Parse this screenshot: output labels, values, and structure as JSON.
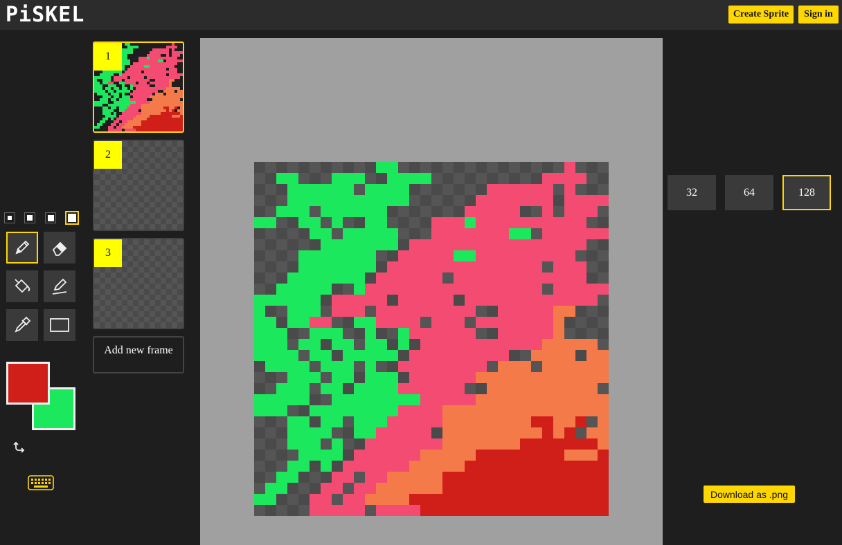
{
  "app": {
    "logo": "PiSKEL"
  },
  "header": {
    "create_sprite_label": "Create Sprite",
    "sign_in_label": "Sign in"
  },
  "tools": {
    "pen_sizes": [
      "1",
      "2",
      "3",
      "4"
    ],
    "selected_pen_size": 4,
    "items": [
      {
        "name": "pen-icon",
        "active": true
      },
      {
        "name": "eraser-icon",
        "active": false
      },
      {
        "name": "paint-bucket-icon",
        "active": false
      },
      {
        "name": "stroke-icon",
        "active": false
      },
      {
        "name": "eyedropper-icon",
        "active": false
      },
      {
        "name": "rectangle-icon",
        "active": false
      }
    ],
    "primary_color": "#d01f18",
    "secondary_color": "#1be85c",
    "swap_icon": "swap-arrow-icon",
    "keyboard_icon": "keyboard-icon"
  },
  "frames": {
    "items": [
      {
        "number": "1",
        "active": true
      },
      {
        "number": "2",
        "active": false
      },
      {
        "number": "3",
        "active": false
      }
    ],
    "add_label": "Add new frame"
  },
  "palette": {
    "green": "#1be85c",
    "pink": "#f44b73",
    "orange": "#f57a4a",
    "red": "#d01f18",
    "checker_dark": "#4a4a4a",
    "checker_light": "#555555",
    "accent": "#ffd700"
  },
  "canvas": {
    "grid_size": 32,
    "legend": {
      ".": "transparent",
      "G": "green",
      "P": "pink",
      "O": "orange",
      "R": "red"
    },
    "rows": [
      "...........GG...............P.",
      "..GG...GGG..GGGG..........PPPP",
      "...GGGGGG.GGGG.......PPPPPP.P.",
      "...GGGGGGGGGGG......PPPPPPP.PPPP",
      "..GGG.GGGGGG.......PPPPP..P.PPP",
      "GG..GG.G..GG....PPPGPPPPPPPPPP.",
      ".....GG.GGGGG...PPPPPPPGG.PPPPPP",
      "......GGGGGGG.PPPPPPPPPPPPPPPP..",
      "....GGGGGGG..PPPPPGGPPPPPPPPP...",
      "....GGGGGGG.PPPPPPPPPPPPPP.PPP..",
      "...GGGGGGG.PPPPPP.PPPPPPPPPPPP..",
      "..GGGGG..GPPPPPPPPPPPPPPPP.PPPPP",
      "GGGGGG.PPPPP.PPPPP.PPPPPPPPPPPP.",
      "G..GGG.PPP.PPPPPPPPP..PPPPPOO...",
      "GG.GGPP..GGPPPP.PPP.PPPPPPPO...",
      "GGG..GGG..G..GPPPPPP..PPPPPO...",
      "GGG.GG.GG.GG.G.PPPPPPPPPPPOOOOO",
      "GGGG.GG.GGGGG.PPPPPPPPP..OOOO.OO",
      ".GGGG.GGG.G..PPPPPPPP.OOO.OOOOOO",
      "...GGG.GG.GGG.PPPPPPOOOOOOOOOOOO",
      "..GGG.GG.GGGGPPPPPP..OOOOOOOOOO",
      "GGGGG..GGGGGGGGPPPPPOOOOOOOOOOOOO",
      "GGG..GGGGGGGGPPPPOOOOOOOOOOOOOOO",
      "...GG.GG.GGGPPPPPOOOOOOOORROOR.O",
      "...GGGG..GGPPPPP.OOOOOOOOOROR.OO",
      "...GGG.G..PPPPPPPOOOOOOORRRRRRROO",
      "....GGGG.PPPPPPOOOOORRRRRRRROOORR",
      "...GG.G.PPPPPPOOOOORRRRRRRRRRRRR",
      "..GG...PP.PPOOOOORRRRRRRRRRRRRRR",
      ".GG...PP.PPOOOOOORRRRRRRRRRRRRRR",
      "GG...PP.PPOOOORRRRRRRRRRRRRRRRRR",
      ".....PPPPP.PPPPRRRRRRRRRRRRRRRRR"
    ]
  },
  "resize": {
    "options": [
      {
        "label": "32",
        "active": false
      },
      {
        "label": "64",
        "active": false
      },
      {
        "label": "128",
        "active": true
      }
    ]
  },
  "export": {
    "download_label": "Download as .png"
  }
}
